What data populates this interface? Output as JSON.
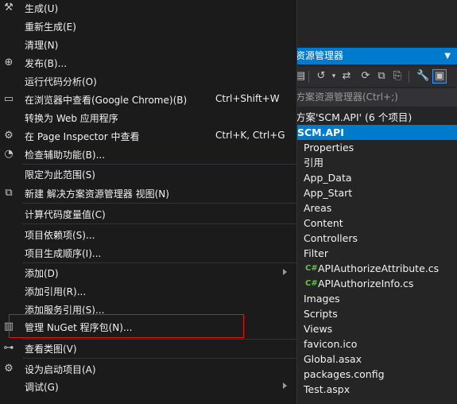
{
  "solution_explorer": {
    "title": "资源管理器",
    "pin_glyph": "▼",
    "search_placeholder": "方案资源管理器(Ctrl+;)",
    "solution_line": "方案'SCM.API' (6 个项目)",
    "project": "SCM.API",
    "items": [
      {
        "label": "Properties"
      },
      {
        "label": "引用"
      },
      {
        "label": "App_Data"
      },
      {
        "label": "App_Start"
      },
      {
        "label": "Areas"
      },
      {
        "label": "Content"
      },
      {
        "label": "Controllers"
      },
      {
        "label": "Filter"
      },
      {
        "label": "APIAuthorizeAttribute.cs",
        "cs": "C#"
      },
      {
        "label": "APIAuthorizeInfo.cs",
        "cs": "C#"
      },
      {
        "label": "Images"
      },
      {
        "label": "Scripts"
      },
      {
        "label": "Views"
      },
      {
        "label": "favicon.ico"
      },
      {
        "label": "Global.asax"
      },
      {
        "label": "packages.config"
      },
      {
        "label": "Test.aspx"
      }
    ]
  },
  "menu": {
    "items": {
      "build": "生成(U)",
      "rebuild": "重新生成(E)",
      "clean": "清理(N)",
      "publish": "发布(B)...",
      "code_analysis": "运行代码分析(O)",
      "view_in_browser": "在浏览器中查看(Google Chrome)(B)",
      "view_in_browser_shortcut": "Ctrl+Shift+W",
      "convert_web_app": "转换为 Web 应用程序",
      "page_inspector": "在 Page Inspector 中查看",
      "page_inspector_shortcut": "Ctrl+K, Ctrl+G",
      "accessibility": "检查辅助功能(B)...",
      "scope_to_this": "限定为此范围(S)",
      "new_se_view": "新建 解决方案资源管理器 视图(N)",
      "code_metrics": "计算代码度量值(C)",
      "dependencies": "项目依赖项(S)...",
      "build_order": "项目生成顺序(I)...",
      "add": "添加(D)",
      "add_reference": "添加引用(R)...",
      "add_service_ref": "添加服务引用(S)...",
      "manage_nuget": "管理 NuGet 程序包(N)...",
      "class_diagram": "查看类图(V)",
      "set_startup": "设为启动项目(A)",
      "debug": "调试(G)"
    }
  }
}
